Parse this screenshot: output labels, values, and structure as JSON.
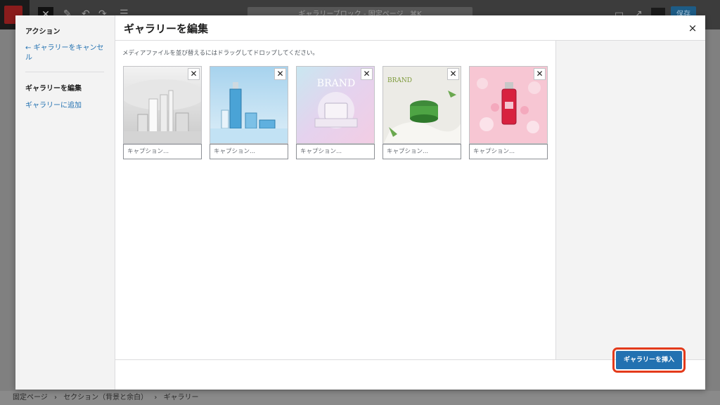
{
  "editor": {
    "doc_title": "ギャラリーブロック - 固定ページ",
    "shortcut": "⌘K",
    "publish_label": "保存"
  },
  "sidebar": {
    "heading": "アクション",
    "cancel_link": "← ギャラリーをキャンセル",
    "section_label": "ギャラリーを編集",
    "add_link": "ギャラリーに追加"
  },
  "modal": {
    "title": "ギャラリーを編集",
    "close_symbol": "×",
    "instructions": "メディアファイルを並び替えるにはドラッグしてドロップしてください。",
    "insert_button": "ギャラリーを挿入"
  },
  "gallery": {
    "caption_placeholder": "キャプション...",
    "remove_symbol": "✕",
    "items": [
      {
        "brand": "",
        "theme": "silver-products"
      },
      {
        "brand": "",
        "theme": "blue-serum"
      },
      {
        "brand": "BRAND",
        "theme": "iridescent-jar"
      },
      {
        "brand": "BRAND",
        "theme": "green-jar"
      },
      {
        "brand": "",
        "theme": "pink-flowers"
      }
    ]
  },
  "footer": {
    "breadcrumb": [
      "固定ページ",
      "セクション（背景と余白）",
      "ギャラリー"
    ],
    "separator": "›"
  }
}
